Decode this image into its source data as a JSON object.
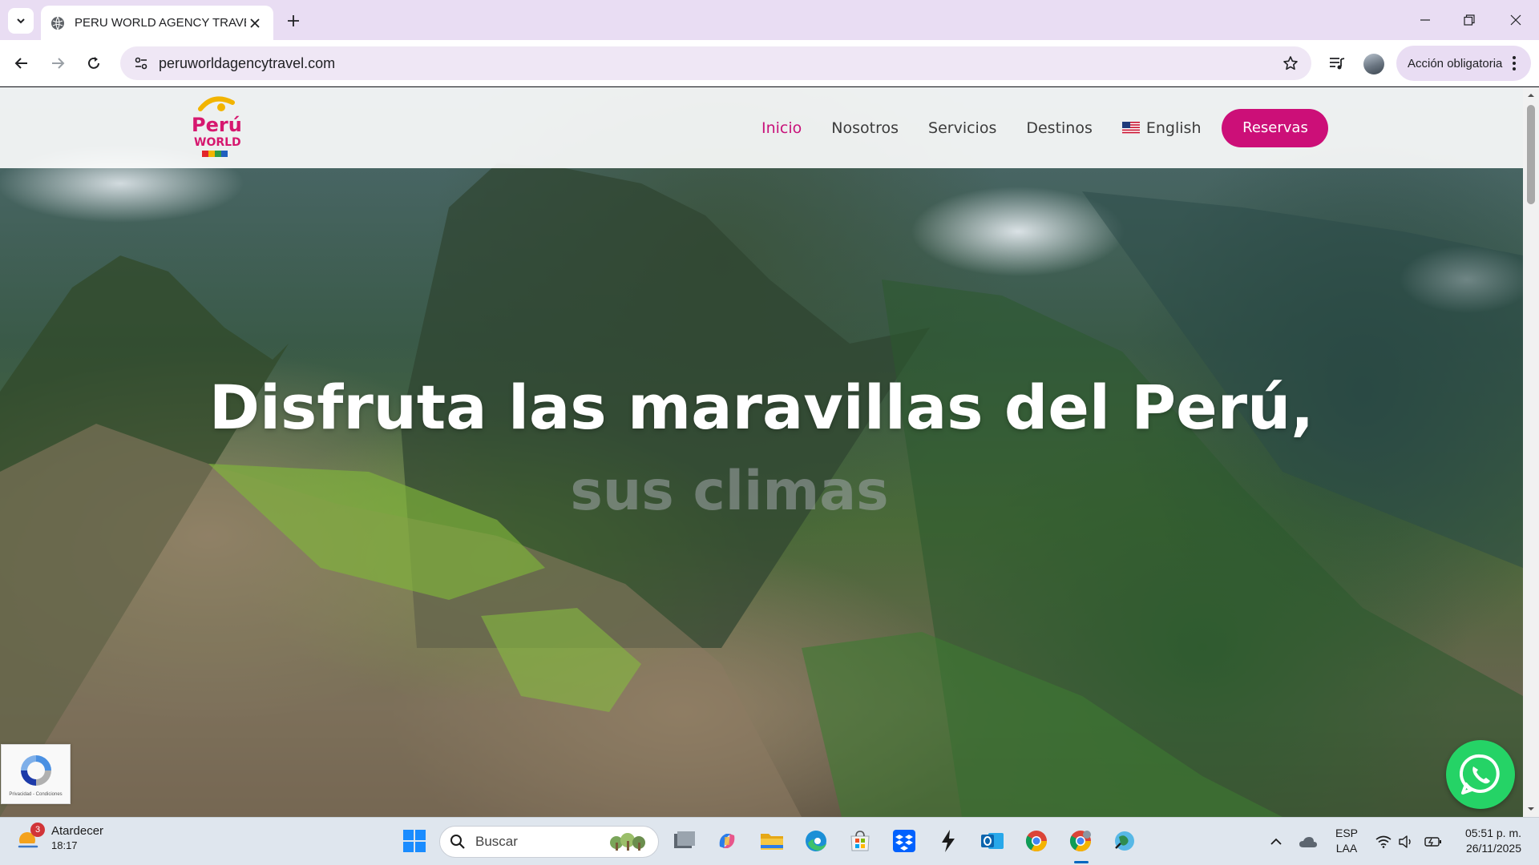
{
  "browser": {
    "tab_title": "PERU WORLD AGENCY TRAVEL",
    "url": "peruworldagencytravel.com",
    "action_label": "Acción obligatoria"
  },
  "site": {
    "logo_text": [
      "Perú",
      "WORLD"
    ],
    "nav": {
      "inicio": "Inicio",
      "nosotros": "Nosotros",
      "servicios": "Servicios",
      "destinos": "Destinos",
      "language": "English",
      "reservas": "Reservas"
    },
    "hero": {
      "title": "Disfruta las maravillas del Perú,",
      "subtitle": "sus climas"
    },
    "recaptcha_text": "Privacidad - Condiciones"
  },
  "taskbar": {
    "weather_badge": "3",
    "weather_label": "Atardecer",
    "weather_temp": "18:17",
    "search_placeholder": "Buscar",
    "lang_line1": "ESP",
    "lang_line2": "LAA",
    "time": "05:51 p. m.",
    "date": "26/11/2025"
  },
  "icons": {
    "tab_search": "chevron-down-icon",
    "back": "arrow-left-icon",
    "forward": "arrow-right-icon",
    "reload": "reload-icon",
    "bookmark": "star-icon",
    "media": "media-controls-icon"
  },
  "colors": {
    "brand_magenta": "#cc0f78",
    "nav_active": "#c8127a",
    "whatsapp_green": "#25d366"
  }
}
